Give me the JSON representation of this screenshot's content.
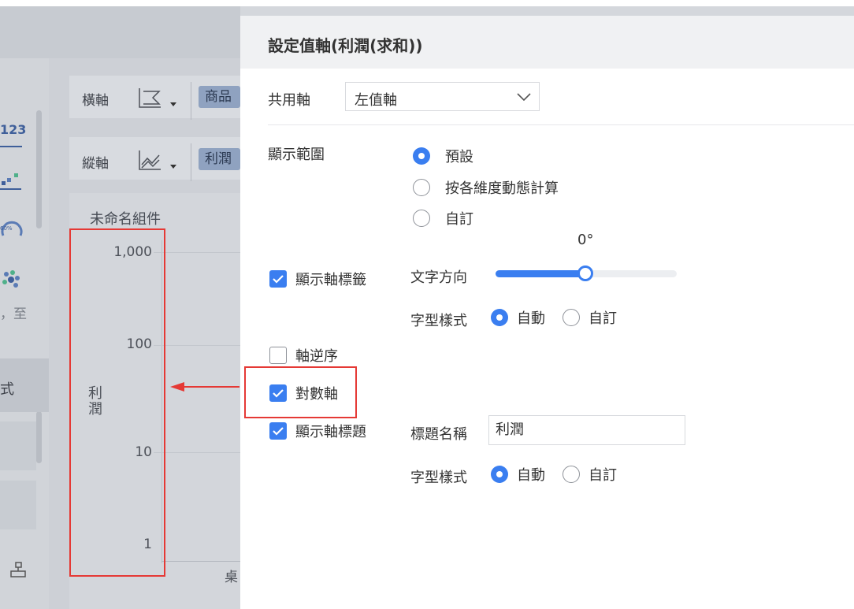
{
  "background": {
    "x_axis_label": "橫軸",
    "x_axis_pill": "商品",
    "y_axis_label": "縱軸",
    "y_axis_pill": "利潤",
    "widget_title": "未命名組件",
    "y_ticks": [
      "1,000",
      "100",
      "10",
      "1"
    ],
    "y_axis_title": "利潤",
    "x_tick_partial": "桌",
    "left_icon_text": "123",
    "left_text_to": "至",
    "left_text_style": "式",
    "left_badge": "60%"
  },
  "panel": {
    "title": "設定值軸(利潤(求和))",
    "shared_axis_label": "共用軸",
    "shared_axis_value": "左值軸",
    "display_range_label": "顯示範圍",
    "range_options": [
      {
        "label": "預設",
        "selected": true
      },
      {
        "label": "按各維度動態計算",
        "selected": false
      },
      {
        "label": "自訂",
        "selected": false
      }
    ],
    "show_axis_labels": {
      "label": "顯示軸標籤",
      "checked": true
    },
    "text_direction_label": "文字方向",
    "text_direction_value": "0°",
    "text_direction_fraction": 0.5,
    "label_font_style_label": "字型樣式",
    "label_font_options": [
      {
        "label": "自動",
        "selected": true
      },
      {
        "label": "自訂",
        "selected": false
      }
    ],
    "reverse_axis": {
      "label": "軸逆序",
      "checked": false
    },
    "log_axis": {
      "label": "對數軸",
      "checked": true
    },
    "show_axis_title": {
      "label": "顯示軸標題",
      "checked": true
    },
    "title_name_label": "標題名稱",
    "title_name_value": "利潤",
    "title_font_style_label": "字型樣式",
    "title_font_options": [
      {
        "label": "自動",
        "selected": true
      },
      {
        "label": "自訂",
        "selected": false
      }
    ]
  },
  "colors": {
    "accent": "#3a7ef0",
    "highlight": "#e53935"
  }
}
